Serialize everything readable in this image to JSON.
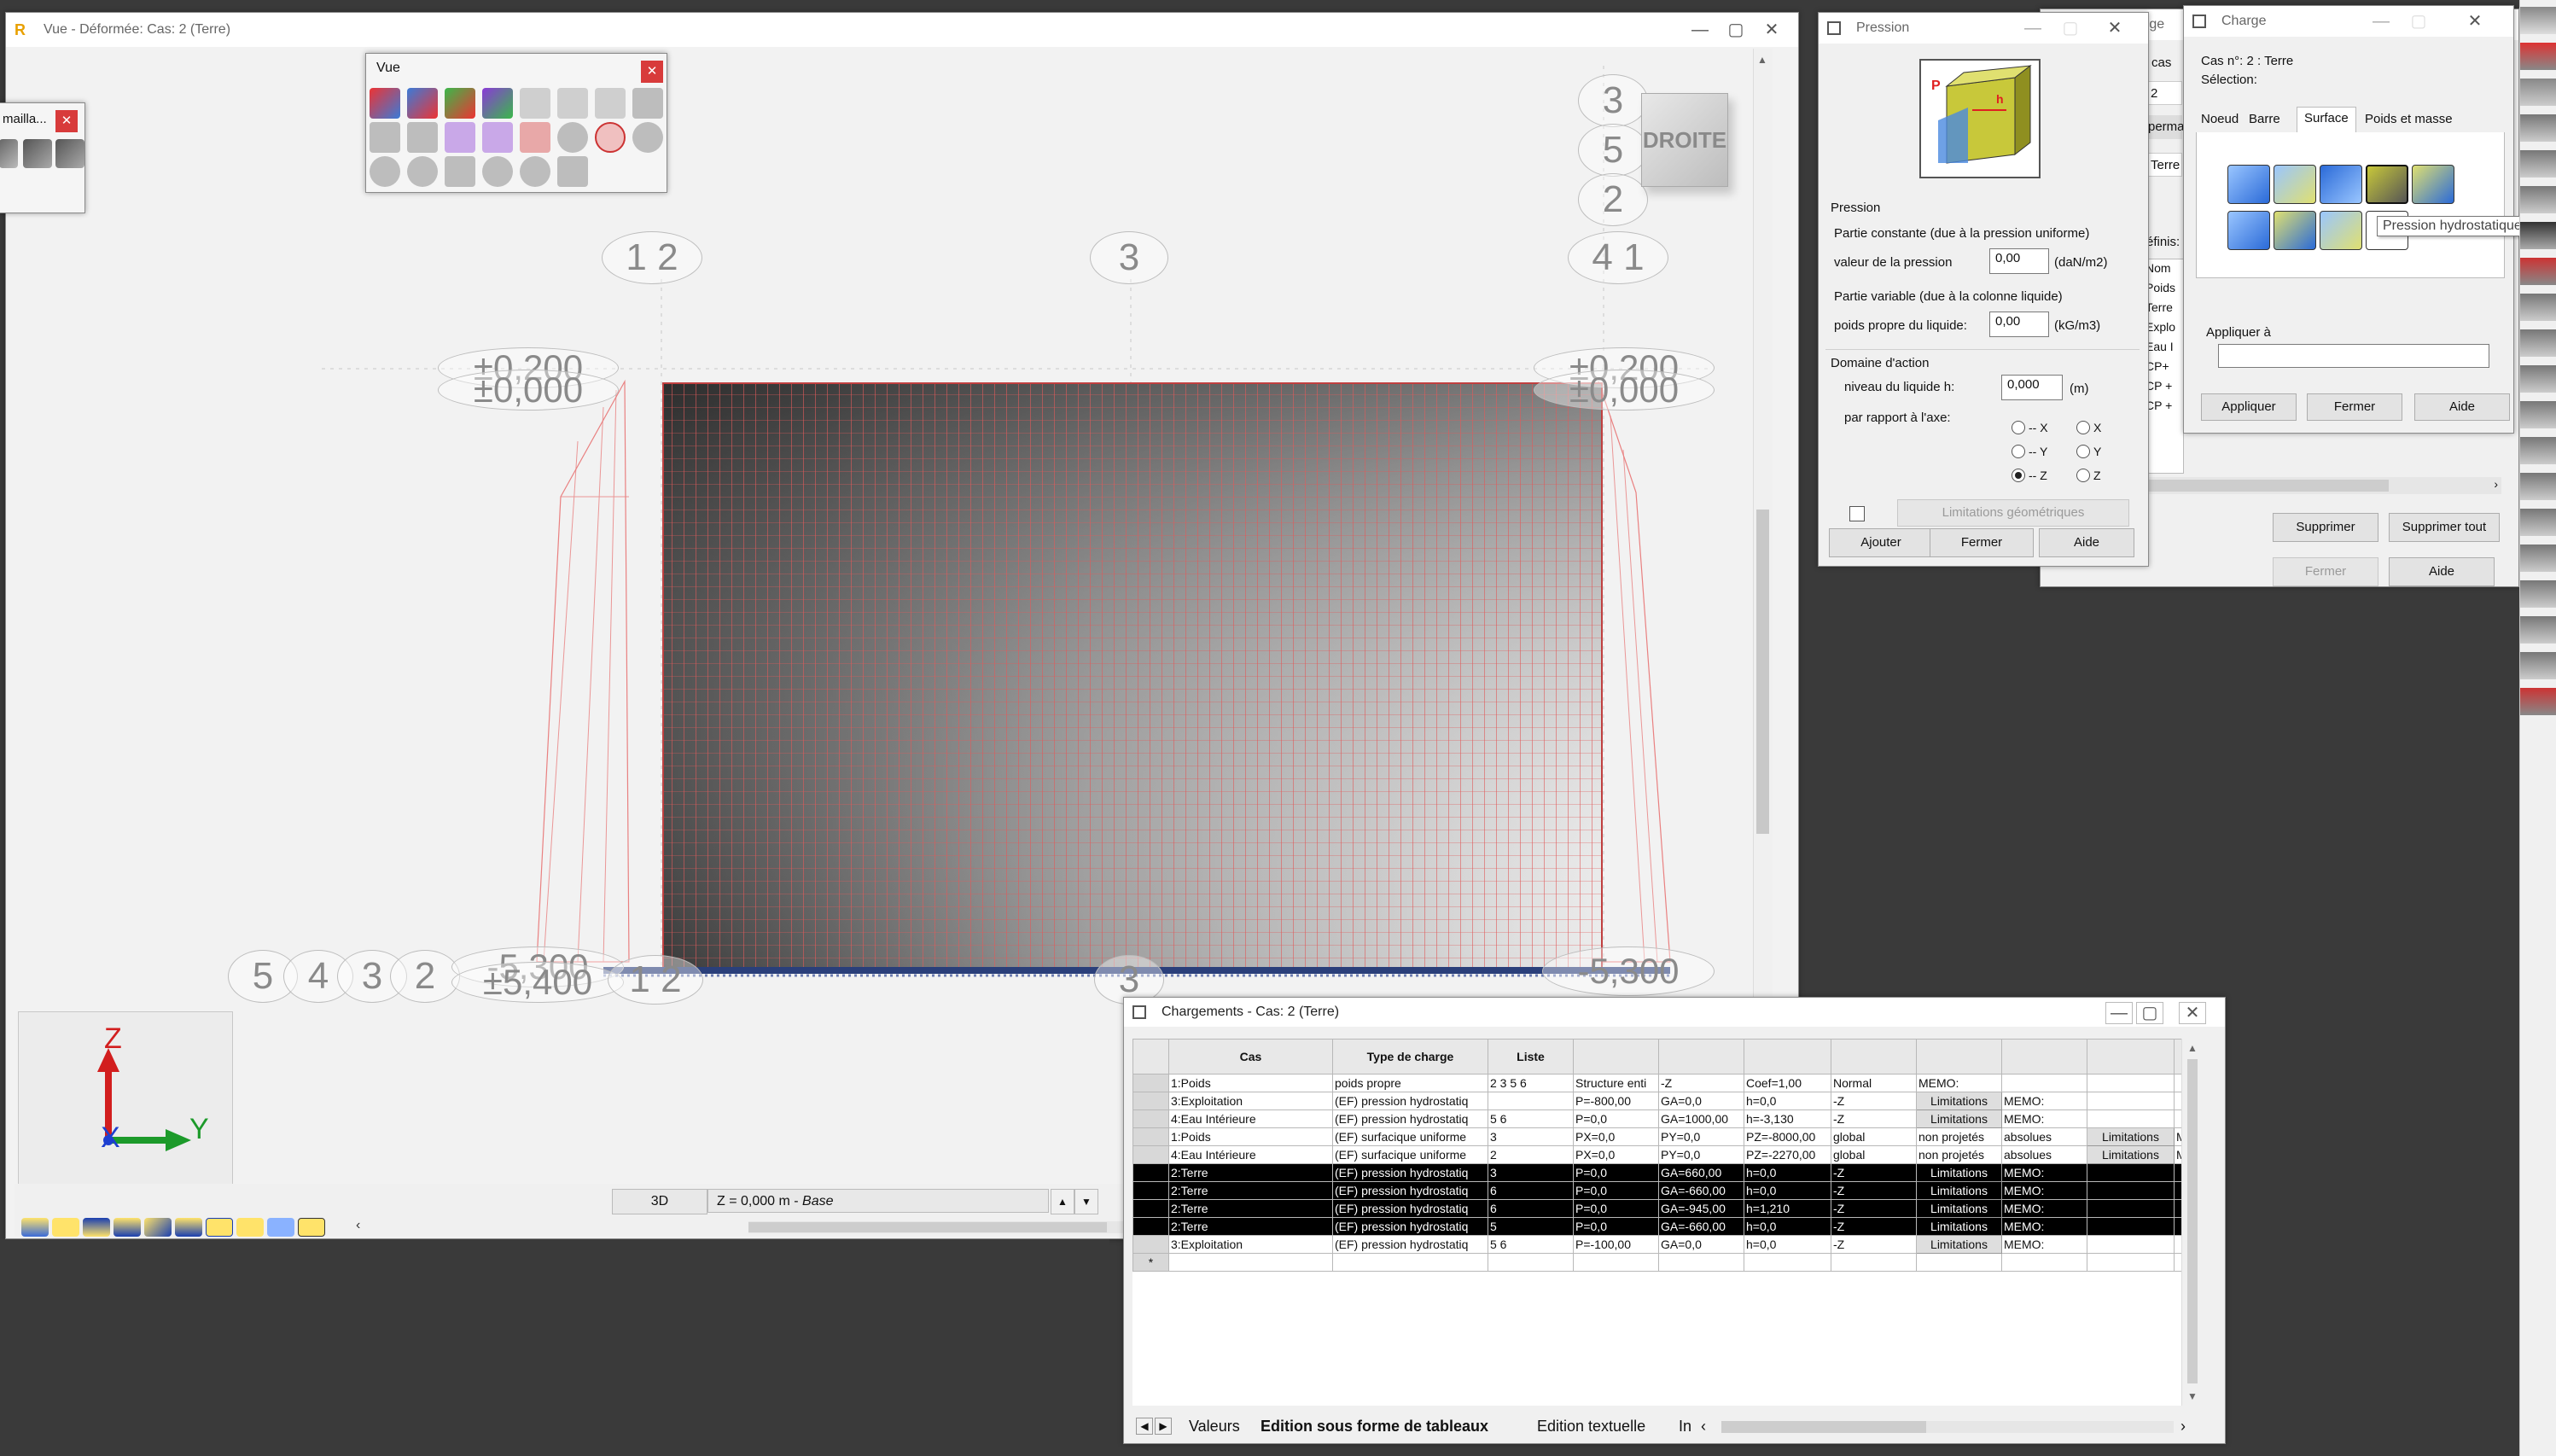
{
  "main_window": {
    "title": "Vue - Déformée: Cas: 2 (Terre)",
    "app_icon": "R"
  },
  "maillage_panel": {
    "title": "mailla..."
  },
  "vue_toolbar": {
    "title": "Vue"
  },
  "viewport": {
    "background": "#f2f2f2",
    "mesh_color": "#e05a5a",
    "axis_top_labels": [
      "1 2",
      "3",
      "4 1"
    ],
    "axis_right_labels": [
      "3",
      "5",
      "2"
    ],
    "axis_bottom_left_labels": [
      "5",
      "4",
      "3",
      "2"
    ],
    "level_labels": {
      "top_left": "±0,200",
      "top_left2": "±0,000",
      "top_right": "±0,200",
      "top_right2": "±0,000",
      "bottom_left": "-5,300",
      "bottom_left2": "±5,400",
      "bottom_right": "-5,300",
      "bottom_mid": "1 2",
      "bottom_center": "3"
    },
    "view_cube_label": "DROITE",
    "axes": {
      "z": "Z",
      "x": "X",
      "y": "Y"
    },
    "status_mode": "3D",
    "status_level": "Z = 0,000 m - ",
    "status_level_italic": "Base"
  },
  "pression_dialog": {
    "title": "Pression",
    "section_pression": "Pression",
    "partie_constante": "Partie constante (due à la pression uniforme)",
    "valeur_label": "valeur de la pression",
    "valeur_value": "0,00",
    "valeur_unit": "(daN/m2)",
    "partie_variable": "Partie variable (due à la colonne liquide)",
    "poids_label": "poids propre du liquide:",
    "poids_value": "0,00",
    "poids_unit": "(kG/m3)",
    "section_domaine": "Domaine d'action",
    "niveau_label": "niveau du liquide h:",
    "niveau_value": "0,000",
    "niveau_unit": "(m)",
    "rapport_label": "par rapport à l'axe:",
    "axis_options": [
      "-- X",
      "X",
      "-- Y",
      "Y",
      "-- Z",
      "Z"
    ],
    "selected_axis": "-- Z",
    "limitations_label": "Limitations géométriques",
    "btn_ajouter": "Ajouter",
    "btn_fermer": "Fermer",
    "btn_aide": "Aide"
  },
  "behind_dialog": {
    "title_fragment": "rge",
    "col_cas": "cas",
    "row_values": [
      "2",
      "perma",
      "Terre"
    ],
    "definis_label": "éfinis:",
    "list_items": [
      "Nom",
      "Poids",
      "Terre",
      "Explo",
      "Eau I",
      "CP+",
      "CP +",
      "CP +"
    ],
    "btn_supprimer": "Supprimer",
    "btn_supprimer_tout": "Supprimer tout",
    "btn_fermer": "Fermer",
    "btn_aide": "Aide"
  },
  "charge_dialog": {
    "title": "Charge",
    "cas_label": "Cas n°: 2 : Terre",
    "selection_label": "Sélection:",
    "tabs": [
      "Noeud",
      "Barre",
      "Surface",
      "Poids et masse"
    ],
    "active_tab": "Surface",
    "tooltip": "Pression hydrostatique",
    "appliquer_a_label": "Appliquer à",
    "appliquer_a_value": "",
    "btn_appliquer": "Appliquer",
    "btn_fermer": "Fermer",
    "btn_aide": "Aide"
  },
  "chargements_window": {
    "title": "Chargements - Cas: 2 (Terre)",
    "columns": [
      "Cas",
      "Type de charge",
      "Liste",
      "",
      "",
      "",
      "",
      "",
      "",
      "",
      ""
    ],
    "rows": [
      {
        "cells": [
          "1:Poids",
          "poids propre",
          "2 3 5 6",
          "Structure enti",
          "-Z",
          "Coef=1,00",
          "Normal",
          "MEMO:",
          "",
          "",
          ""
        ],
        "selected": false
      },
      {
        "cells": [
          "3:Exploitation",
          "(EF) pression hydrostatiq",
          "",
          "P=-800,00",
          "GA=0,0",
          "h=0,0",
          "-Z",
          "Limitations",
          "MEMO:",
          "",
          ""
        ],
        "selected": false
      },
      {
        "cells": [
          "4:Eau Intérieure",
          "(EF) pression hydrostatiq",
          "5 6",
          "P=0,0",
          "GA=1000,00",
          "h=-3,130",
          "-Z",
          "Limitations",
          "MEMO:",
          "",
          ""
        ],
        "selected": false
      },
      {
        "cells": [
          "1:Poids",
          "(EF) surfacique uniforme",
          "3",
          "PX=0,0",
          "PY=0,0",
          "PZ=-8000,00",
          "global",
          "non projetés",
          "absolues",
          "Limitations",
          "ME"
        ],
        "selected": false
      },
      {
        "cells": [
          "4:Eau Intérieure",
          "(EF) surfacique uniforme",
          "2",
          "PX=0,0",
          "PY=0,0",
          "PZ=-2270,00",
          "global",
          "non projetés",
          "absolues",
          "Limitations",
          "ME"
        ],
        "selected": false
      },
      {
        "cells": [
          "2:Terre",
          "(EF) pression hydrostatiq",
          "3",
          "P=0,0",
          "GA=660,00",
          "h=0,0",
          "-Z",
          "Limitations",
          "MEMO:",
          "",
          ""
        ],
        "selected": true
      },
      {
        "cells": [
          "2:Terre",
          "(EF) pression hydrostatiq",
          "6",
          "P=0,0",
          "GA=-660,00",
          "h=0,0",
          "-Z",
          "Limitations",
          "MEMO:",
          "",
          ""
        ],
        "selected": true
      },
      {
        "cells": [
          "2:Terre",
          "(EF) pression hydrostatiq",
          "6",
          "P=0,0",
          "GA=-945,00",
          "h=1,210",
          "-Z",
          "Limitations",
          "MEMO:",
          "",
          ""
        ],
        "selected": true
      },
      {
        "cells": [
          "2:Terre",
          "(EF) pression hydrostatiq",
          "5",
          "P=0,0",
          "GA=-660,00",
          "h=0,0",
          "-Z",
          "Limitations",
          "MEMO:",
          "",
          ""
        ],
        "selected": true
      },
      {
        "cells": [
          "3:Exploitation",
          "(EF) pression hydrostatiq",
          "5 6",
          "P=-100,00",
          "GA=0,0",
          "h=0,0",
          "-Z",
          "Limitations",
          "MEMO:",
          "",
          ""
        ],
        "selected": false
      }
    ],
    "new_row_marker": "*",
    "bottom_tabs": [
      "Valeurs",
      "Edition sous forme de tableaux",
      "Edition textuelle",
      "In"
    ],
    "active_bottom_tab": "Edition sous forme de tableaux"
  }
}
